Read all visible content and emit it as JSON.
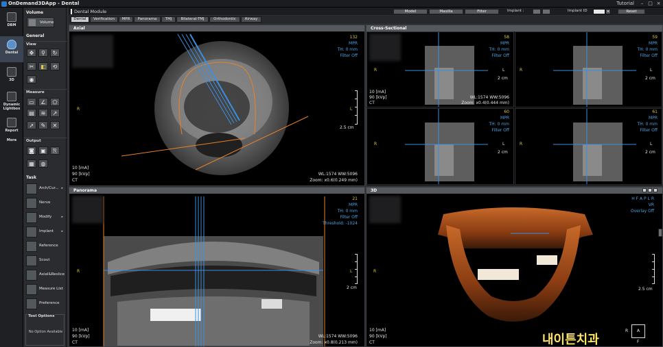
{
  "app": {
    "title": "OnDemand3DApp - Dental",
    "tutorial": "Tutorial"
  },
  "leftnav": [
    {
      "label": "DBM",
      "icon": "database-icon"
    },
    {
      "label": "Dental",
      "icon": "tooth-icon"
    },
    {
      "label": "3D",
      "icon": "cube-icon"
    },
    {
      "label": "Dynamic Lightbox",
      "icon": "lightbox-icon"
    },
    {
      "label": "Report",
      "icon": "report-icon"
    },
    {
      "label": "More",
      "icon": "more-icon"
    }
  ],
  "tools": {
    "volume_header": "Volume",
    "volume_button": "Volume",
    "general_header": "General",
    "view_header": "View",
    "measure_header": "Measure",
    "output_header": "Output",
    "task_header": "Task",
    "tasks": [
      {
        "label": "Arch/Cur...",
        "arrow": "▸"
      },
      {
        "label": "Nerve",
        "arrow": ""
      },
      {
        "label": "Modify",
        "arrow": "▸"
      },
      {
        "label": "Implant",
        "arrow": "▸"
      },
      {
        "label": "Reference",
        "arrow": ""
      },
      {
        "label": "Scout",
        "arrow": ""
      },
      {
        "label": "Axial&Reslice",
        "arrow": ""
      },
      {
        "label": "Measure List",
        "arrow": ""
      },
      {
        "label": "Preference",
        "arrow": ""
      }
    ],
    "tool_options_title": "Tool Options",
    "tool_options_text": "No Option Available"
  },
  "module": {
    "title": "Dental Module",
    "buttons": {
      "model": "Model",
      "maxilla": "Maxilla",
      "filter": "Filter",
      "reset": "Reset"
    },
    "implant_label": "Implant :",
    "implant_id_label": "Implant ID"
  },
  "tabs": [
    "Dental",
    "Verification",
    "MPR",
    "Panorama",
    "TMJ",
    "Bilateral-TMJ",
    "Orthodontic",
    "Airway"
  ],
  "axial": {
    "title": "Axial",
    "slice": "132",
    "mode": "MPR",
    "th": "TH: 0 mm",
    "filter": "Filter Off",
    "r": "R",
    "l": "L",
    "scale": "2.5 cm",
    "ma": "10 [mA]",
    "kvp": "90 [kVp]",
    "ct": "CT",
    "wl": "WL:1574 WW:5096",
    "zoom": "Zoom: x0.6(0.249 mm)"
  },
  "cross": {
    "title": "Cross-Sectional",
    "cells": [
      {
        "slice": "58",
        "mode": "MPR",
        "th": "TH: 0 mm",
        "filter": "Filter Off",
        "r": "R",
        "l": "L",
        "scale": "2 cm"
      },
      {
        "slice": "59",
        "mode": "MPR",
        "th": "TH: 0 mm",
        "filter": "Filter Off",
        "r": "R",
        "l": "L",
        "scale": "2 cm"
      },
      {
        "slice": "60",
        "mode": "MPR",
        "th": "TH: 0 mm",
        "filter": "Filter Off",
        "r": "R",
        "l": "L",
        "scale": "2 cm"
      },
      {
        "slice": "61",
        "mode": "MPR",
        "th": "TH: 0 mm",
        "filter": "Filter Off",
        "r": "R",
        "l": "L",
        "scale": "2 cm"
      }
    ],
    "ma": "10 [mA]",
    "kvp": "90 [kVp]",
    "ct": "CT",
    "wl": "WL:1574 WW:5096",
    "zoom": "Zoom: x0.4(0.444 mm)"
  },
  "panorama": {
    "title": "Panorama",
    "slice": "21",
    "mode": "MPR",
    "th": "TH: 0 mm",
    "filter": "Filter Off",
    "threshold": "Threshold: -1024",
    "r": "R",
    "l": "L",
    "scale": "2 cm",
    "ma": "10 [mA]",
    "kvp": "90 [kVp]",
    "ct": "CT",
    "wl": "WL:1574 WW:5096",
    "zoom": "Zoom: x0.8(0.213 mm)"
  },
  "view3d": {
    "title": "3D",
    "orient": "H F A P L R",
    "mode": "VR",
    "overlay": "Overlay Off",
    "r": "R",
    "scale": "2.5 cm",
    "ma": "10 [mA]",
    "kvp": "90 [kVp]",
    "ct": "CT",
    "box_r": "R",
    "box_a": "A",
    "box_f": "F",
    "watermark": "내이튼치과"
  },
  "colors": {
    "overlay_yellow": "#d8c848",
    "overlay_blue": "#4fa3e0",
    "curve_orange": "#e8822a"
  }
}
